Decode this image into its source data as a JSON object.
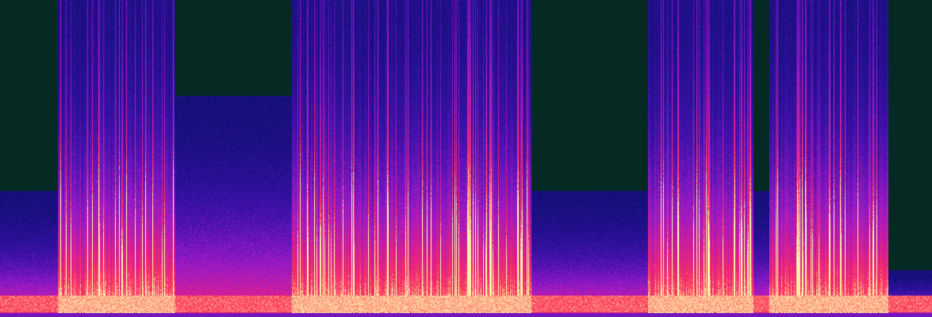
{
  "colors": {
    "background_silence": "#052a24",
    "low_energy": "#0b0f6e",
    "mid_low": "#3a10a8",
    "mid": "#9a1ac8",
    "mid_high": "#e0208a",
    "high": "#ff3a5a",
    "peak": "#fff0a8"
  },
  "spectrogram": {
    "colormap": "magma-like",
    "active_segments": [
      {
        "start": 0.062,
        "end": 0.188
      },
      {
        "start": 0.313,
        "end": 0.57
      },
      {
        "start": 0.695,
        "end": 0.808
      },
      {
        "start": 0.825,
        "end": 0.953
      }
    ],
    "quiet_segments": [
      {
        "start": 0.0,
        "end": 0.062,
        "band_top": 0.6
      },
      {
        "start": 0.188,
        "end": 0.313,
        "band_top": 0.3
      },
      {
        "start": 0.57,
        "end": 0.695,
        "band_top": 0.6
      },
      {
        "start": 0.808,
        "end": 0.825,
        "band_top": 0.6
      },
      {
        "start": 0.953,
        "end": 1.0,
        "band_top": 0.85
      }
    ]
  }
}
